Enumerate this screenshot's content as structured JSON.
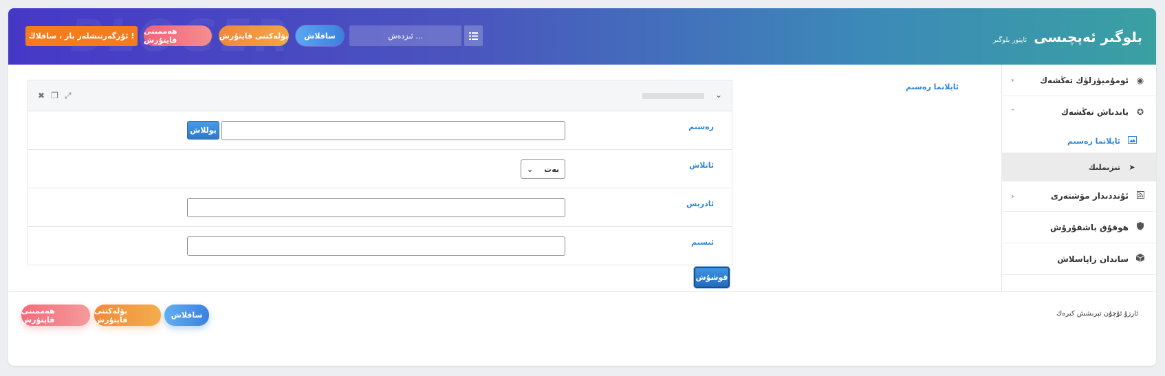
{
  "header": {
    "brand_title": "بلوگىر ئەپچىسى",
    "brand_subtitle": "ئاپتور بلوگىر",
    "lang_button": "ئۇرگەرتىشلەر بار ، ساقلاڭ !",
    "all_button": "ھەممىنى قايتۇرش",
    "category_button": "بۆلەكتنى قايتۇرش",
    "save_button": "ساقلاش",
    "search_placeholder": "ئىزدەش ..."
  },
  "sidebar": {
    "items": [
      {
        "label": "ئومۇميۈزلۈك تەڭشەك",
        "icon": "podcast-icon"
      },
      {
        "label": "ياندىاش تەڭشەك",
        "icon": "settings-icon"
      },
      {
        "label": "ئۇنددىدار مۆشتەرى",
        "icon": "rss-icon"
      },
      {
        "label": "ھوقۇق باشقۇرۇش",
        "icon": "shield-icon"
      },
      {
        "label": "ساندان زاپاسلاش",
        "icon": "box-icon"
      }
    ],
    "sub_items": [
      {
        "label": "ئايلانما رەسىم",
        "icon": "image-icon"
      },
      {
        "label": "تىزىملىك",
        "icon": "send-icon"
      }
    ]
  },
  "breadcrumb": "ئايلانما رەسىم",
  "form": {
    "rows": [
      {
        "label": "رەسىم"
      },
      {
        "label": "ئاتلاش"
      },
      {
        "label": "ئادرېس"
      },
      {
        "label": "ئىسىم"
      }
    ],
    "upload_button": "يوللاش",
    "select_value": "بەت",
    "submit_button": "قوشۇش"
  },
  "footer": {
    "text": "ئارزۇ ئۇچۇن تېرىشش كىرەك",
    "save_button": "ساقلاش",
    "category_button": "بۆلەكتنى قايتۇرش",
    "all_button": "ھەممىنى قايتۇرش"
  }
}
